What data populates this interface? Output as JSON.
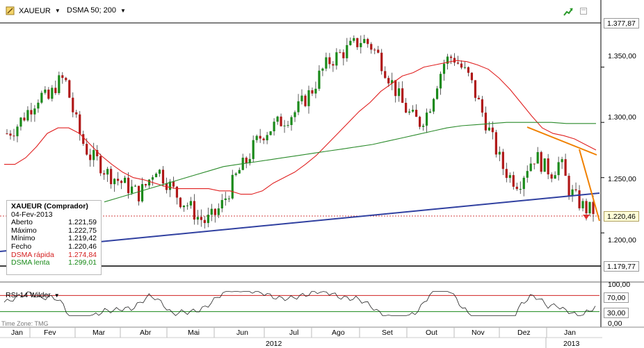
{
  "toolbar": {
    "symbol": "XAUEUR",
    "indicator": "DSMA 50; 200"
  },
  "legend": {
    "title": "XAUEUR (Comprador)",
    "date": "04-Fev-2013",
    "rows": [
      {
        "label": "Aberto",
        "value": "1.221,59"
      },
      {
        "label": "Máximo",
        "value": "1.222,75"
      },
      {
        "label": "Mínimo",
        "value": "1.219,42"
      },
      {
        "label": "Fecho",
        "value": "1.220,46"
      }
    ],
    "fast": {
      "label": "DSMA rápida",
      "value": "1.274,84"
    },
    "slow": {
      "label": "DSMA lenta",
      "value": "1.299,01"
    }
  },
  "price_tags": {
    "high": "1.377,87",
    "current": "1.220,46",
    "low": "1.179,77"
  },
  "rsi": {
    "label": "RSI 14 Wilder",
    "upper": "70,00",
    "lower": "30,00",
    "axis_top": "100,00",
    "axis_bottom": "0,00"
  },
  "timezone": "Time Zone: TMG",
  "colors": {
    "fast": "#e02020",
    "slow": "#2a8a2a",
    "trend": "#3040a0",
    "orange": "#f08000",
    "up": "#1a8a1a",
    "down": "#b01818"
  },
  "chart_data": {
    "type": "line",
    "title": "",
    "ylim": [
      1170,
      1390
    ],
    "y_ticks": [
      "1.350,00",
      "1.300,00",
      "1.250,00",
      "1.200,00"
    ],
    "y_tick_values": [
      1350,
      1300,
      1250,
      1200
    ],
    "x_ticks": [
      "Jan",
      "Fev",
      "Mar",
      "Abr",
      "Mai",
      "Jun",
      "Jul",
      "Ago",
      "Set",
      "Out",
      "Nov",
      "Dez",
      "Jan"
    ],
    "years": [
      "2012",
      "2013"
    ],
    "series": [
      {
        "name": "XAUEUR",
        "values": [
          1290,
          1295,
          1305,
          1315,
          1325,
          1320,
          1335,
          1340,
          1310,
          1285,
          1270,
          1265,
          1255,
          1250,
          1245,
          1240,
          1235,
          1245,
          1260,
          1250,
          1240,
          1230,
          1225,
          1215,
          1210,
          1215,
          1225,
          1240,
          1255,
          1265,
          1280,
          1290,
          1295,
          1300,
          1305,
          1310,
          1320,
          1330,
          1345,
          1355,
          1360,
          1365,
          1370,
          1375,
          1370,
          1360,
          1345,
          1330,
          1315,
          1305,
          1300,
          1310,
          1335,
          1355,
          1360,
          1350,
          1340,
          1320,
          1300,
          1280,
          1260,
          1250,
          1245,
          1260,
          1270,
          1260,
          1255,
          1265,
          1240,
          1230,
          1222,
          1220
        ]
      },
      {
        "name": "DSMA rápida",
        "values": [
          1262,
          1262,
          1268,
          1278,
          1290,
          1295,
          1295,
          1290,
          1280,
          1270,
          1262,
          1255,
          1250,
          1248,
          1245,
          1242,
          1240,
          1240,
          1240,
          1240,
          1238,
          1238,
          1235,
          1235,
          1238,
          1245,
          1250,
          1255,
          1262,
          1270,
          1280,
          1290,
          1300,
          1310,
          1318,
          1328,
          1335,
          1342,
          1345,
          1350,
          1352,
          1354,
          1356,
          1355,
          1352,
          1348,
          1340,
          1330,
          1318,
          1306,
          1295,
          1290,
          1288,
          1285,
          1280,
          1275
        ]
      },
      {
        "name": "DSMA lenta",
        "values": [
          1228,
          1232,
          1236,
          1240,
          1244,
          1248,
          1252,
          1256,
          1260,
          1262,
          1264,
          1266,
          1268,
          1270,
          1272,
          1274,
          1276,
          1278,
          1280,
          1283,
          1286,
          1289,
          1292,
          1295,
          1297,
          1298,
          1299,
          1300,
          1300,
          1300,
          1300,
          1299,
          1299,
          1299
        ]
      }
    ]
  }
}
